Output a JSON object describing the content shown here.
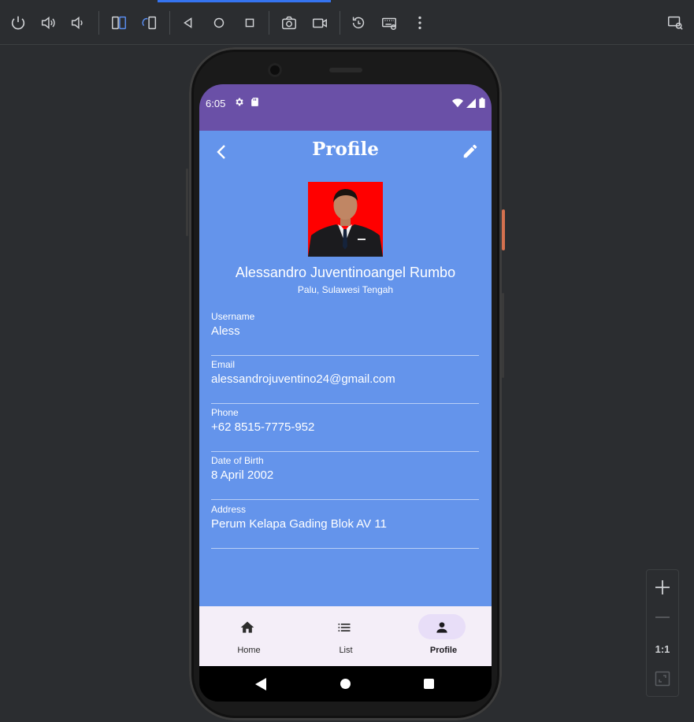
{
  "toolbar": {
    "icons": [
      "power-icon",
      "volume-up-icon",
      "volume-down-icon",
      "rotate-left-icon",
      "rotate-right-icon",
      "back-icon",
      "home-icon",
      "overview-icon",
      "screenshot-icon",
      "screen-record-icon",
      "snapshot-icon",
      "keyboard-icon",
      "more-icon",
      "device-mirror-icon"
    ],
    "accent": "#3574f0"
  },
  "status_bar": {
    "time": "6:05",
    "color": "#6a50a7"
  },
  "app": {
    "title": "Profile",
    "background": "#6494eb",
    "name": "Alessandro Juventinoangel Rumbo",
    "location": "Palu, Sulawesi Tengah",
    "fields": [
      {
        "label": "Username",
        "value": "Aless"
      },
      {
        "label": "Email",
        "value": "alessandrojuventino24@gmail.com"
      },
      {
        "label": "Phone",
        "value": "+62 8515-7775-952"
      },
      {
        "label": "Date of Birth",
        "value": "8 April 2002"
      },
      {
        "label": "Address",
        "value": "Perum Kelapa Gading Blok AV 11"
      }
    ]
  },
  "bottom_nav": {
    "items": [
      {
        "label": "Home",
        "icon": "home-icon"
      },
      {
        "label": "List",
        "icon": "list-icon"
      },
      {
        "label": "Profile",
        "icon": "person-icon",
        "active": true
      }
    ]
  },
  "zoom": {
    "one_to_one": "1:1"
  }
}
